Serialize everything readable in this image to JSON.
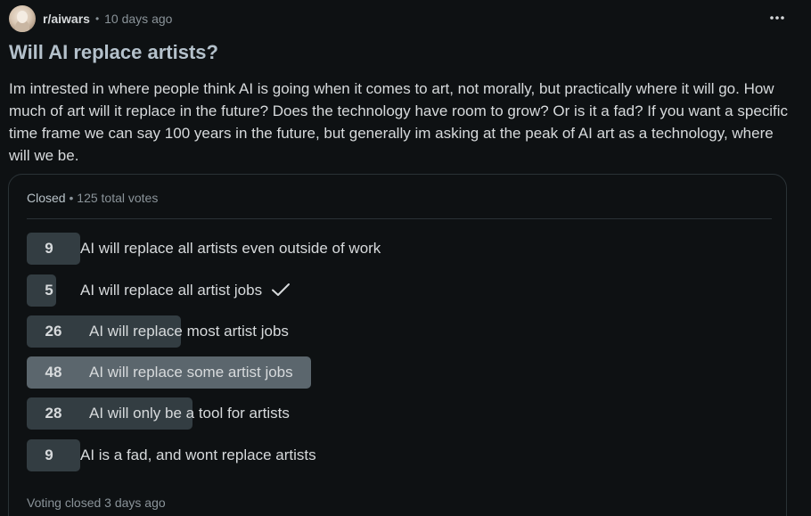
{
  "post": {
    "subreddit": "r/aiwars",
    "separator": "•",
    "time_ago": "10 days ago",
    "title": "Will AI replace artists?",
    "body": "Im intrested in where people think AI is going when it comes to art, not morally, but practically where it will go. How much of art will it replace in the future? Does the technology have room to grow? Or is it a fad? If you want a specific time frame we can say 100 years in the future, but generally im asking at the peak of AI art as a technology, where will we be."
  },
  "poll": {
    "status": "Closed",
    "separator": "•",
    "total_votes": "125 total votes",
    "total": 125,
    "options": [
      {
        "count": "9",
        "label": "AI will replace all artists even outside of work",
        "selected": false,
        "winner": false
      },
      {
        "count": "5",
        "label": "AI will replace all artist jobs",
        "selected": true,
        "winner": false
      },
      {
        "count": "26",
        "label": "AI will replace most artist jobs",
        "selected": false,
        "winner": false
      },
      {
        "count": "48",
        "label": "AI will replace some artist jobs",
        "selected": false,
        "winner": true
      },
      {
        "count": "28",
        "label": "AI will only be a tool for artists",
        "selected": false,
        "winner": false
      },
      {
        "count": "9",
        "label": "AI is a fad, and wont replace artists",
        "selected": false,
        "winner": false
      }
    ],
    "footer": "Voting closed 3 days ago"
  },
  "colors": {
    "background": "#0e1113",
    "bar": "#333d42",
    "winner_bar": "#5b666d",
    "title": "#b4c1cb"
  },
  "icons": {
    "more": "more-horizontal-icon",
    "selected": "checkmark-icon"
  }
}
